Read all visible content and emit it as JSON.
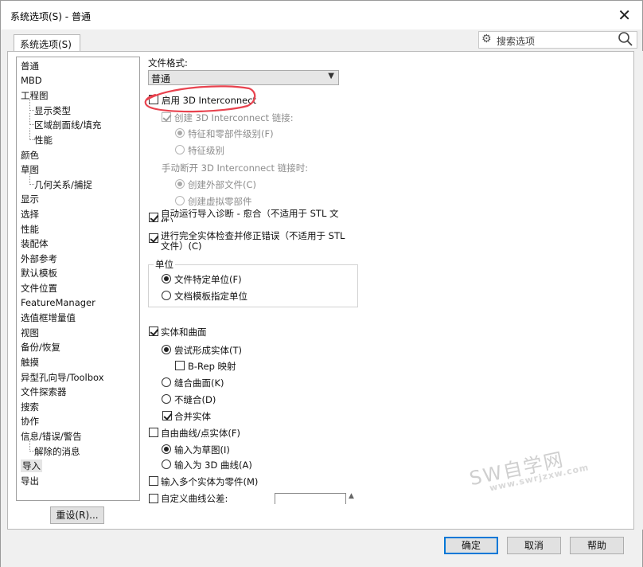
{
  "window": {
    "title": "系统选项(S) - 普通",
    "close_glyph": "✕"
  },
  "tab": {
    "label": "系统选项(S)"
  },
  "search": {
    "placeholder": "搜索选项",
    "gear_icon": "gear-icon",
    "search_icon": "magnifier-icon"
  },
  "tree": {
    "items": [
      {
        "label": "普通",
        "child": false,
        "selected": false
      },
      {
        "label": "MBD",
        "child": false,
        "selected": false
      },
      {
        "label": "工程图",
        "child": false,
        "selected": false
      },
      {
        "label": "显示类型",
        "child": true,
        "selected": false
      },
      {
        "label": "区域剖面线/填充",
        "child": true,
        "selected": false
      },
      {
        "label": "性能",
        "child": true,
        "selected": false
      },
      {
        "label": "颜色",
        "child": false,
        "selected": false
      },
      {
        "label": "草图",
        "child": false,
        "selected": false
      },
      {
        "label": "几何关系/捕捉",
        "child": true,
        "selected": false
      },
      {
        "label": "显示",
        "child": false,
        "selected": false
      },
      {
        "label": "选择",
        "child": false,
        "selected": false
      },
      {
        "label": "性能",
        "child": false,
        "selected": false
      },
      {
        "label": "装配体",
        "child": false,
        "selected": false
      },
      {
        "label": "外部参考",
        "child": false,
        "selected": false
      },
      {
        "label": "默认模板",
        "child": false,
        "selected": false
      },
      {
        "label": "文件位置",
        "child": false,
        "selected": false
      },
      {
        "label": "FeatureManager",
        "child": false,
        "selected": false
      },
      {
        "label": "选值框增量值",
        "child": false,
        "selected": false
      },
      {
        "label": "视图",
        "child": false,
        "selected": false
      },
      {
        "label": "备份/恢复",
        "child": false,
        "selected": false
      },
      {
        "label": "触摸",
        "child": false,
        "selected": false
      },
      {
        "label": "异型孔向导/Toolbox",
        "child": false,
        "selected": false
      },
      {
        "label": "文件探索器",
        "child": false,
        "selected": false
      },
      {
        "label": "搜索",
        "child": false,
        "selected": false
      },
      {
        "label": "协作",
        "child": false,
        "selected": false
      },
      {
        "label": "信息/错误/警告",
        "child": false,
        "selected": false
      },
      {
        "label": "解除的消息",
        "child": true,
        "selected": false
      },
      {
        "label": "导入",
        "child": false,
        "selected": true
      },
      {
        "label": "导出",
        "child": false,
        "selected": false
      }
    ],
    "reset_button": "重设(R)..."
  },
  "options": {
    "file_format_label": "文件格式:",
    "file_format_value": "普通",
    "enable_3d_interconnect": "启用 3D Interconnect",
    "create_link": "创建 3D Interconnect 链接:",
    "feature_and_part_level": "特征和零部件级别(F)",
    "feature_level": "特征级别",
    "manual_break_label": "手动断开 3D Interconnect 链接时:",
    "create_external_file": "创建外部文件(C)",
    "create_virtual_part": "创建虚拟零部件",
    "auto_diag": "自动运行导入诊断 - 愈合（不适用于 STL 文件）",
    "auto_diag_line1": "自动运行导入诊断 - 愈合（不适用于 STL 文",
    "auto_diag_line2": "件）",
    "full_check_line1": "进行完全实体检查并修正错误（不适用于 STL",
    "full_check_line2": "文件）(C)",
    "units_group": "单位",
    "file_specified_units": "文件特定单位(F)",
    "template_units": "文档模板指定单位",
    "solids_and_surfaces": "实体和曲面",
    "try_form_solid": "尝试形成实体(T)",
    "brep_mapping": "B-Rep 映射",
    "knit_surfaces": "缝合曲面(K)",
    "no_knit": "不缝合(D)",
    "merge_solids": "合并实体",
    "free_curves": "自由曲线/点实体(F)",
    "import_as_sketch": "输入为草图(I)",
    "import_as_3d_curve": "输入为 3D 曲线(A)",
    "multi_body_as_part": "输入多个实体为零件(M)",
    "custom_curve_tolerance": "自定义曲线公差:"
  },
  "watermark": {
    "big": "SW自学网",
    "small": "www.swrjzxw.com"
  },
  "footer": {
    "ok": "确定",
    "cancel": "取消",
    "help": "帮助"
  },
  "colors": {
    "highlight_stroke": "#e8434f",
    "default_button_border": "#0078d7"
  }
}
